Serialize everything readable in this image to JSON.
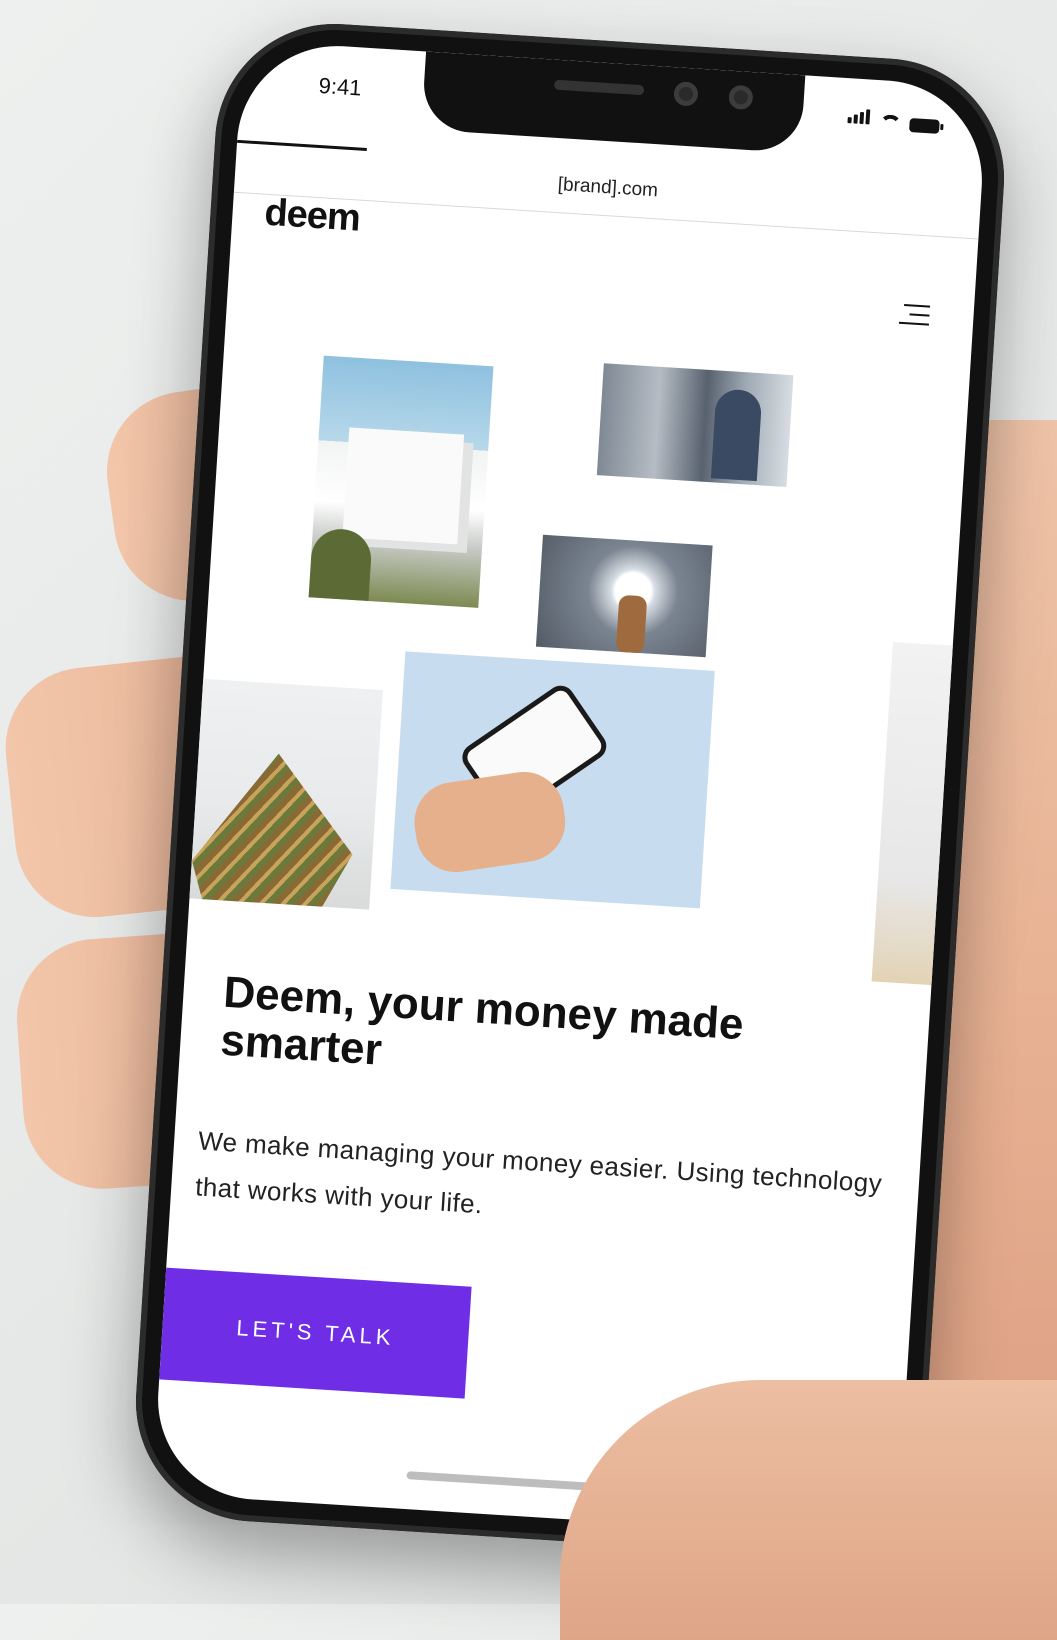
{
  "status_bar": {
    "time": "9:41"
  },
  "browser": {
    "url": "[brand].com"
  },
  "site": {
    "logo": "deem",
    "hero": {
      "headline": "Deem, your money made smarter",
      "subtext": "We make managing your money easier. Using technology that works with your life.",
      "cta_label": "LET'S TALK"
    }
  },
  "colors": {
    "accent": "#6f2ee6",
    "background": "#ffffff",
    "text": "#111111"
  },
  "icons": [
    "signal-icon",
    "wifi-icon",
    "battery-icon",
    "hamburger-menu-icon"
  ]
}
